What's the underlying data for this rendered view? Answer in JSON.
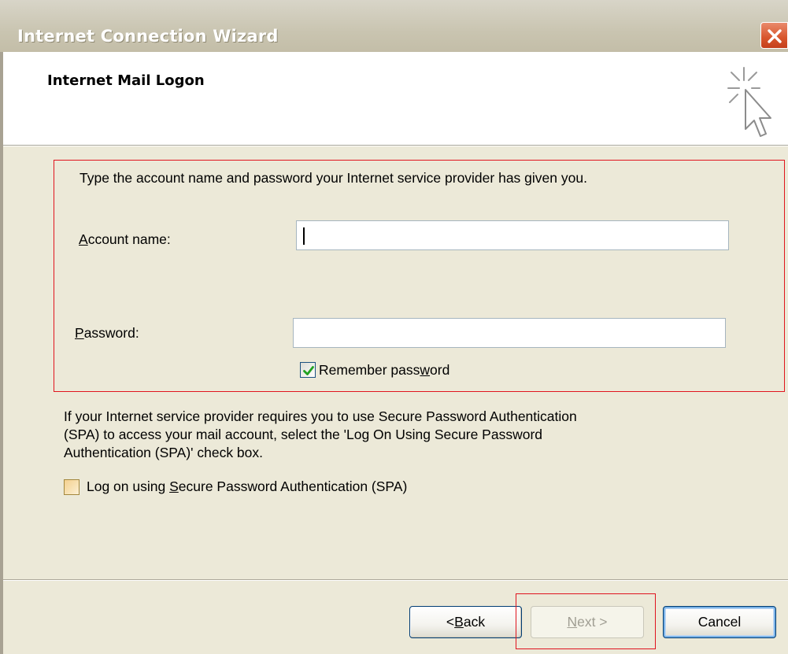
{
  "window": {
    "title": "Internet Connection Wizard",
    "close_icon": "close-icon"
  },
  "header": {
    "heading": "Internet Mail Logon",
    "icon": "wizard-sparkle-cursor-icon"
  },
  "form": {
    "intro": "Type the account name and password your Internet service provider has given you.",
    "account_label_mnemonic": "A",
    "account_label_rest": "ccount name:",
    "account_value": "",
    "password_label_mnemonic": "P",
    "password_label_rest": "assword:",
    "password_value": "",
    "remember_label_pre": "Remember pass",
    "remember_label_mnemonic": "w",
    "remember_label_post": "ord",
    "remember_checked": true
  },
  "spa": {
    "line1": "If your Internet service provider requires you to use Secure Password Authentication",
    "line2": "(SPA) to access your mail account, select the 'Log On Using Secure Password",
    "line3": "Authentication (SPA)' check box.",
    "checkbox_label_pre": "Log on using ",
    "checkbox_label_mnemonic": "S",
    "checkbox_label_post": "ecure Password Authentication (SPA)",
    "checkbox_checked": false
  },
  "buttons": {
    "back_pre": "< ",
    "back_mnemonic": "B",
    "back_post": "ack",
    "next_mnemonic": "N",
    "next_post": "ext >",
    "cancel": "Cancel"
  },
  "colors": {
    "highlight": "#e0141e",
    "dialog_bg": "#ece9d8",
    "checkmark": "#21a121"
  }
}
